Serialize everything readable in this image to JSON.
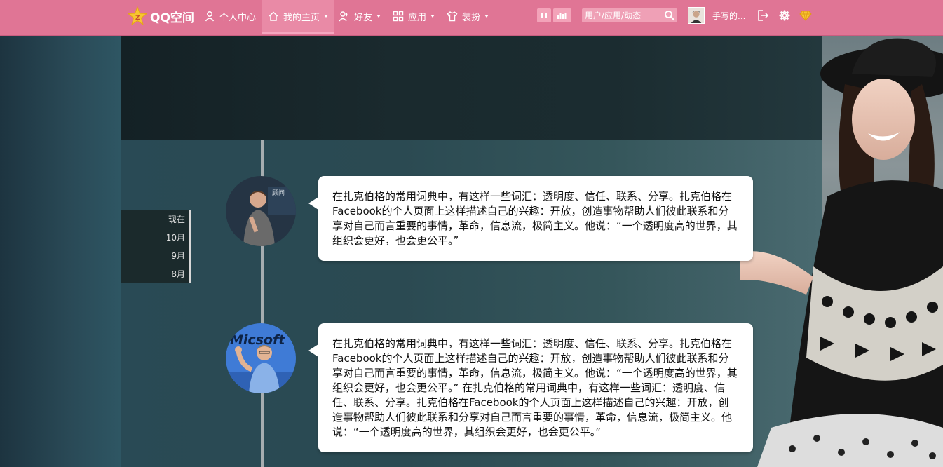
{
  "app": {
    "name": "QQ空间"
  },
  "nav": {
    "items": [
      {
        "label": "个人中心",
        "icon": "person-icon",
        "has_menu": false,
        "active": false
      },
      {
        "label": "我的主页",
        "icon": "home-icon",
        "has_menu": true,
        "active": true
      },
      {
        "label": "好友",
        "icon": "friends-icon",
        "has_menu": true,
        "active": false
      },
      {
        "label": "应用",
        "icon": "apps-grid-icon",
        "has_menu": true,
        "active": false
      },
      {
        "label": "装扮",
        "icon": "tshirt-icon",
        "has_menu": true,
        "active": false
      }
    ]
  },
  "search": {
    "placeholder": "用户/应用/动态"
  },
  "user": {
    "name": "手写的..."
  },
  "colors": {
    "topbar": "#e07595",
    "active_tab": "#e98aa6",
    "bubble": "#ffffff"
  },
  "timeline": {
    "dates": [
      "现在",
      "10月",
      "9月",
      "8月"
    ],
    "posts": [
      {
        "avatar": "mark-zuckerberg-photo",
        "text": "在扎克伯格的常用词典中，有这样一些词汇：透明度、信任、联系、分享。扎克伯格在Facebook的个人页面上这样描述自己的兴趣：开放，创造事物帮助人们彼此联系和分享对自己而言重要的事情，革命，信息流，极简主义。他说：“一个透明度高的世界，其组织会更好，也会更公平。”"
      },
      {
        "avatar": "bill-gates-photo",
        "text": "在扎克伯格的常用词典中，有这样一些词汇：透明度、信任、联系、分享。扎克伯格在Facebook的个人页面上这样描述自己的兴趣：开放，创造事物帮助人们彼此联系和分享对自己而言重要的事情，革命，信息流，极简主义。他说：“一个透明度高的世界，其组织会更好，也会更公平。” 在扎克伯格的常用词典中，有这样一些词汇：透明度、信任、联系、分享。扎克伯格在Facebook的个人页面上这样描述自己的兴趣：开放，创造事物帮助人们彼此联系和分享对自己而言重要的事情，革命，信息流，极简主义。他说：“一个透明度高的世界，其组织会更好，也会更公平。”"
      }
    ]
  }
}
